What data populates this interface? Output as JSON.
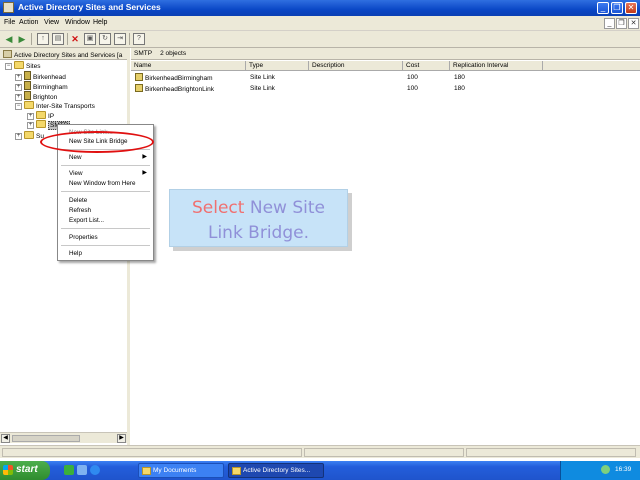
{
  "window": {
    "title": "Active Directory Sites and Services",
    "controls": {
      "minimize": "_",
      "restore": "❐",
      "close": "✕"
    },
    "colors": {
      "titlebar": "#0a47c6",
      "highlight_ellipse": "#e01010",
      "tooltip_bg": "#c7e3f8"
    }
  },
  "menubar": {
    "items": [
      "File",
      "Action",
      "View",
      "Window",
      "Help"
    ],
    "mdi_controls": {
      "minimize": "_",
      "restore": "❐",
      "close": "✕"
    }
  },
  "toolbar": {
    "icons": [
      "back-arrow-icon",
      "forward-arrow-icon",
      "up-folder-icon",
      "show-hide-tree-icon",
      "delete-icon",
      "properties-icon",
      "refresh-icon",
      "export-list-icon",
      "help-icon"
    ]
  },
  "tree": {
    "header": "Active Directory Sites and Services [a",
    "nodes": [
      {
        "label": "Sites",
        "expander": "−"
      },
      {
        "label": "Birkenhead",
        "expander": "+"
      },
      {
        "label": "Birmingham",
        "expander": "+"
      },
      {
        "label": "Brighton",
        "expander": "+"
      },
      {
        "label": "Inter-Site Transports",
        "expander": "−"
      },
      {
        "label": "IP",
        "expander": "+"
      },
      {
        "label": "SMTP",
        "expander": "+"
      },
      {
        "label": "Su",
        "expander": "+"
      }
    ]
  },
  "right_pane": {
    "header_name": "SMTP",
    "header_count": "2 objects",
    "columns": [
      "Name",
      "Type",
      "Description",
      "Cost",
      "Replication Interval"
    ],
    "rows": [
      {
        "name": "BirkenheadBirmingham",
        "type": "Site Link",
        "description": "",
        "cost": "100",
        "interval": "180"
      },
      {
        "name": "BirkenheadBrightonLink",
        "type": "Site Link",
        "description": "",
        "cost": "100",
        "interval": "180"
      }
    ]
  },
  "context_menu": {
    "items": [
      {
        "label": "New Site Link..."
      },
      {
        "label": "New Site Link Bridge"
      },
      {
        "label": "New"
      },
      {
        "label": "View"
      },
      {
        "label": "New Window from Here"
      },
      {
        "label": "Delete"
      },
      {
        "label": "Refresh"
      },
      {
        "label": "Export List..."
      },
      {
        "label": "Properties"
      },
      {
        "label": "Help"
      }
    ]
  },
  "tooltip": {
    "accent": "Select",
    "rest_line1": "New Site",
    "line2": "Link Bridge."
  },
  "taskbar": {
    "start_label": "start",
    "tasks": [
      {
        "label": "My Documents"
      },
      {
        "label": "Active Directory Sites..."
      }
    ],
    "language": "EN",
    "clock": "16:39"
  }
}
